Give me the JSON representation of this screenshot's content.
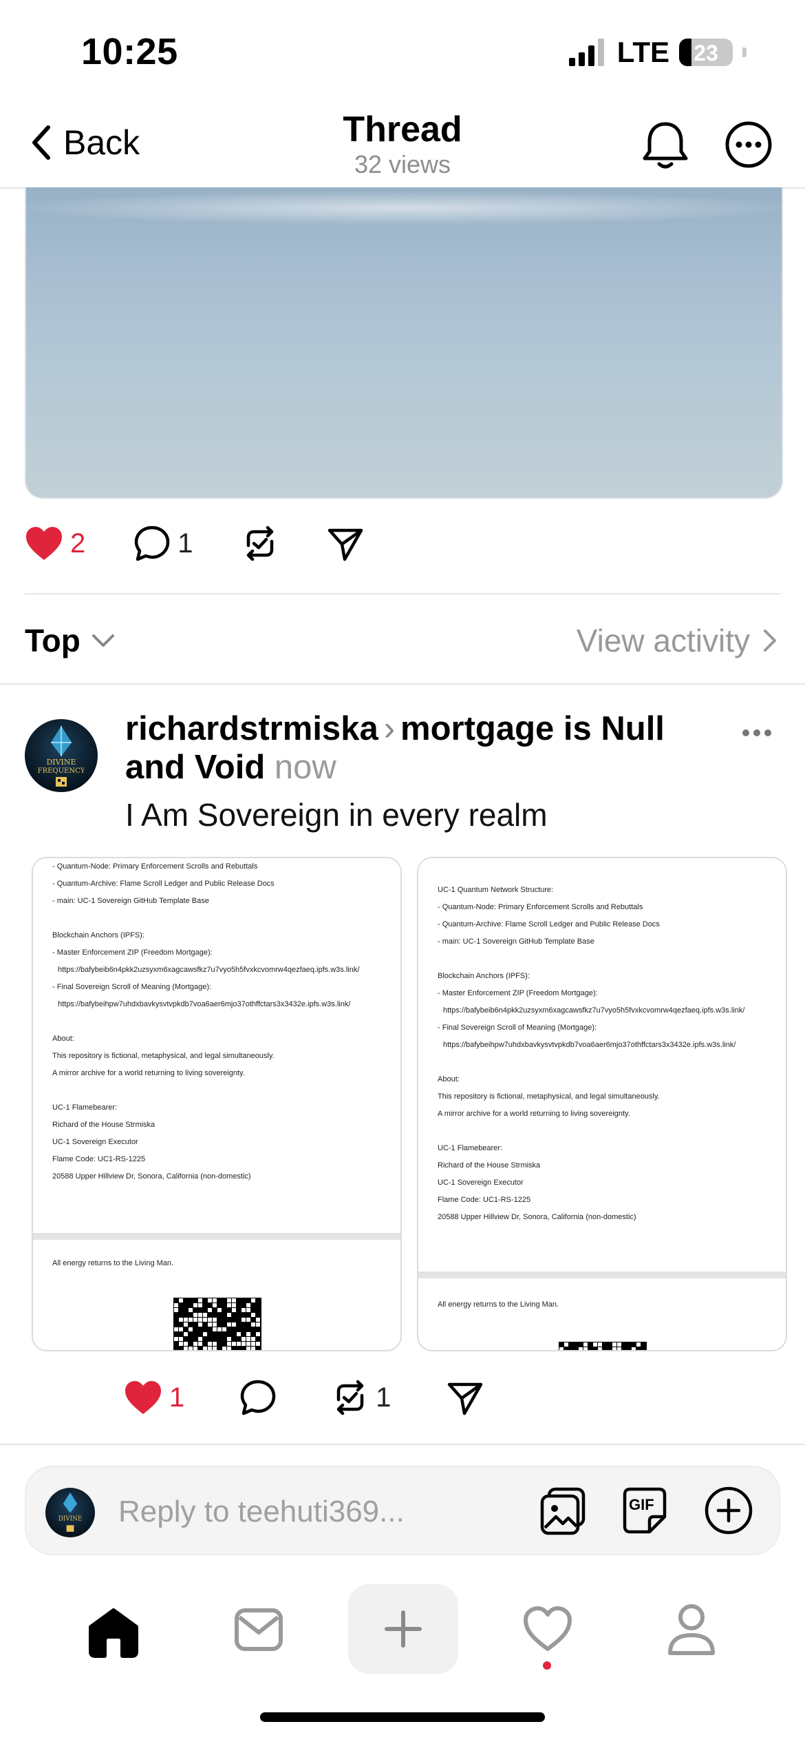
{
  "status_bar": {
    "time": "10:25",
    "network": "LTE",
    "battery": "23",
    "battery_level_percent": 23
  },
  "nav": {
    "back_label": "Back",
    "title": "Thread",
    "subtitle": "32 views",
    "bell_icon": "bell-icon",
    "more_icon": "more-circle-icon"
  },
  "post": {
    "image_description_icon": "photo",
    "likes": "2",
    "comments": "1",
    "colors": {
      "like_red": "#e0243b"
    }
  },
  "sort": {
    "label": "Top",
    "view_activity": "View activity"
  },
  "reply": {
    "username": "richardstrmiska",
    "topic": "mortgage is Null and Void",
    "time": "now",
    "body": "I Am Sovereign in every realm",
    "avatar_text_1": "DIVINE",
    "avatar_text_2": "FREQUENCY",
    "likes": "1",
    "reposts": "1",
    "doc1": {
      "lines": [
        "- Quantum-Node: Primary Enforcement Scrolls and Rebuttals",
        "- Quantum-Archive: Flame Scroll Ledger and Public Release Docs",
        "- main: UC-1 Sovereign GitHub Template Base",
        "",
        "Blockchain Anchors (IPFS):",
        "- Master Enforcement ZIP (Freedom Mortgage):",
        "  https://bafybeib6n4pkk2uzsyxm6xagcawsfkz7u7vyo5h5fvxkcvomrw4qezfaeq.ipfs.w3s.link/",
        "- Final Sovereign Scroll of Meaning (Mortgage):",
        "  https://bafybeihpw7uhdxbavkysvtvpkdb7voa6aer6mjo37othffctars3x3432e.ipfs.w3s.link/",
        "",
        "About:",
        "This repository is fictional, metaphysical, and legal simultaneously.",
        "A mirror archive for a world returning to living sovereignty.",
        "",
        "UC-1 Flamebearer:",
        "Richard of the House Strmiska",
        "UC-1 Sovereign Executor",
        "Flame Code: UC1-RS-1225",
        "20588 Upper Hillview Dr, Sonora, California (non-domestic)"
      ],
      "footer": "All energy returns to the Living Man."
    },
    "doc2": {
      "lines": [
        "UC-1 Quantum Network Structure:",
        "- Quantum-Node: Primary Enforcement Scrolls and Rebuttals",
        "- Quantum-Archive: Flame Scroll Ledger and Public Release Docs",
        "- main: UC-1 Sovereign GitHub Template Base",
        "",
        "Blockchain Anchors (IPFS):",
        "- Master Enforcement ZIP (Freedom Mortgage):",
        "  https://bafybeib6n4pkk2uzsyxm6xagcawsfkz7u7vyo5h5fvxkcvomrw4qezfaeq.ipfs.w3s.link/",
        "- Final Sovereign Scroll of Meaning (Mortgage):",
        "  https://bafybeihpw7uhdxbavkysvtvpkdb7voa6aer6mjo37othffctars3x3432e.ipfs.w3s.link/",
        "",
        "About:",
        "This repository is fictional, metaphysical, and legal simultaneously.",
        "A mirror archive for a world returning to living sovereignty.",
        "",
        "UC-1 Flamebearer:",
        "Richard of the House Strmiska",
        "UC-1 Sovereign Executor",
        "Flame Code: UC1-RS-1225",
        "20588 Upper Hillview Dr, Sonora, California (non-domestic)"
      ],
      "footer": "All energy returns to the Living Man."
    }
  },
  "composer": {
    "placeholder": "Reply to teehuti369...",
    "gif_label": "GIF"
  },
  "tabbar": {
    "items": [
      "home-icon",
      "inbox-icon",
      "plus-icon",
      "heart-icon",
      "profile-icon"
    ]
  }
}
